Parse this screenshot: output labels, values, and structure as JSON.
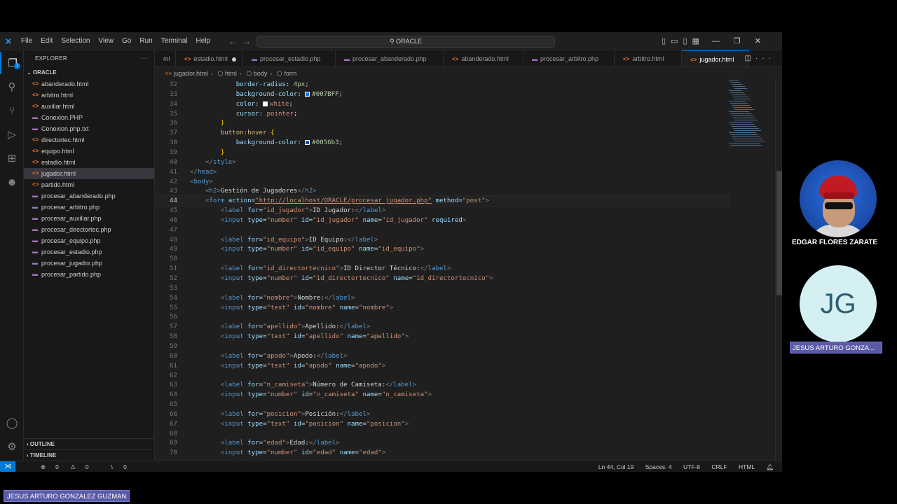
{
  "window": {
    "menu": [
      "File",
      "Edit",
      "Selection",
      "View",
      "Go",
      "Run",
      "Terminal",
      "Help"
    ],
    "search": "ORACLE"
  },
  "explorer": {
    "title": "EXPLORER",
    "root": "ORACLE",
    "files": [
      {
        "name": "abanderado.html",
        "type": "html"
      },
      {
        "name": "arbitro.html",
        "type": "html"
      },
      {
        "name": "auxiliar.html",
        "type": "html"
      },
      {
        "name": "Conexion.PHP",
        "type": "php"
      },
      {
        "name": "Conexion.php.txt",
        "type": "txt"
      },
      {
        "name": "directortec.html",
        "type": "html"
      },
      {
        "name": "equipo.html",
        "type": "html"
      },
      {
        "name": "estadio.html",
        "type": "html"
      },
      {
        "name": "jugador.html",
        "type": "html",
        "active": true
      },
      {
        "name": "partido.html",
        "type": "html"
      },
      {
        "name": "procesar_abanderado.php",
        "type": "php"
      },
      {
        "name": "procesar_arbitro.php",
        "type": "php"
      },
      {
        "name": "procesar_auxiliar.php",
        "type": "php"
      },
      {
        "name": "procesar_directortec.php",
        "type": "php"
      },
      {
        "name": "procesar_equipo.php",
        "type": "php"
      },
      {
        "name": "procesar_estadio.php",
        "type": "php"
      },
      {
        "name": "procesar_jugador.php",
        "type": "php"
      },
      {
        "name": "procesar_partido.php",
        "type": "php"
      }
    ],
    "outline": "OUTLINE",
    "timeline": "TIMELINE"
  },
  "tabs": [
    {
      "label": "ml",
      "icon": ""
    },
    {
      "label": "estadio.html",
      "icon": "html",
      "modified": true
    },
    {
      "label": "procesar_estadio.php",
      "icon": "php"
    },
    {
      "label": "procesar_abanderado.php",
      "icon": "php"
    },
    {
      "label": "abanderado.html",
      "icon": "html"
    },
    {
      "label": "procesar_arbitro.php",
      "icon": "php"
    },
    {
      "label": "arbitro.html",
      "icon": "html"
    },
    {
      "label": "jugador.html",
      "icon": "html",
      "active": true
    }
  ],
  "breadcrumb": [
    "jugador.html",
    "html",
    "body",
    "form"
  ],
  "editor": {
    "current_line": 44,
    "first_line": 32
  },
  "statusbar": {
    "errors": "0",
    "warnings": "0",
    "ports": "0",
    "position": "Ln 44, Col 19",
    "spaces": "Spaces: 4",
    "encoding": "UTF-8",
    "eol": "CRLF",
    "language": "HTML"
  },
  "participants": {
    "edgar": "EDGAR FLORES ZARATE",
    "jesus_initials": "JG",
    "jesus": "JESUS ARTURO GONZA...",
    "presenter": "JESUS ARTURO GONZALEZ GUZMAN"
  },
  "colors": {
    "accent": "#0078d4",
    "swatch_1": "#007BFF",
    "swatch_2": "#ffffff",
    "swatch_3": "#0056b3"
  }
}
